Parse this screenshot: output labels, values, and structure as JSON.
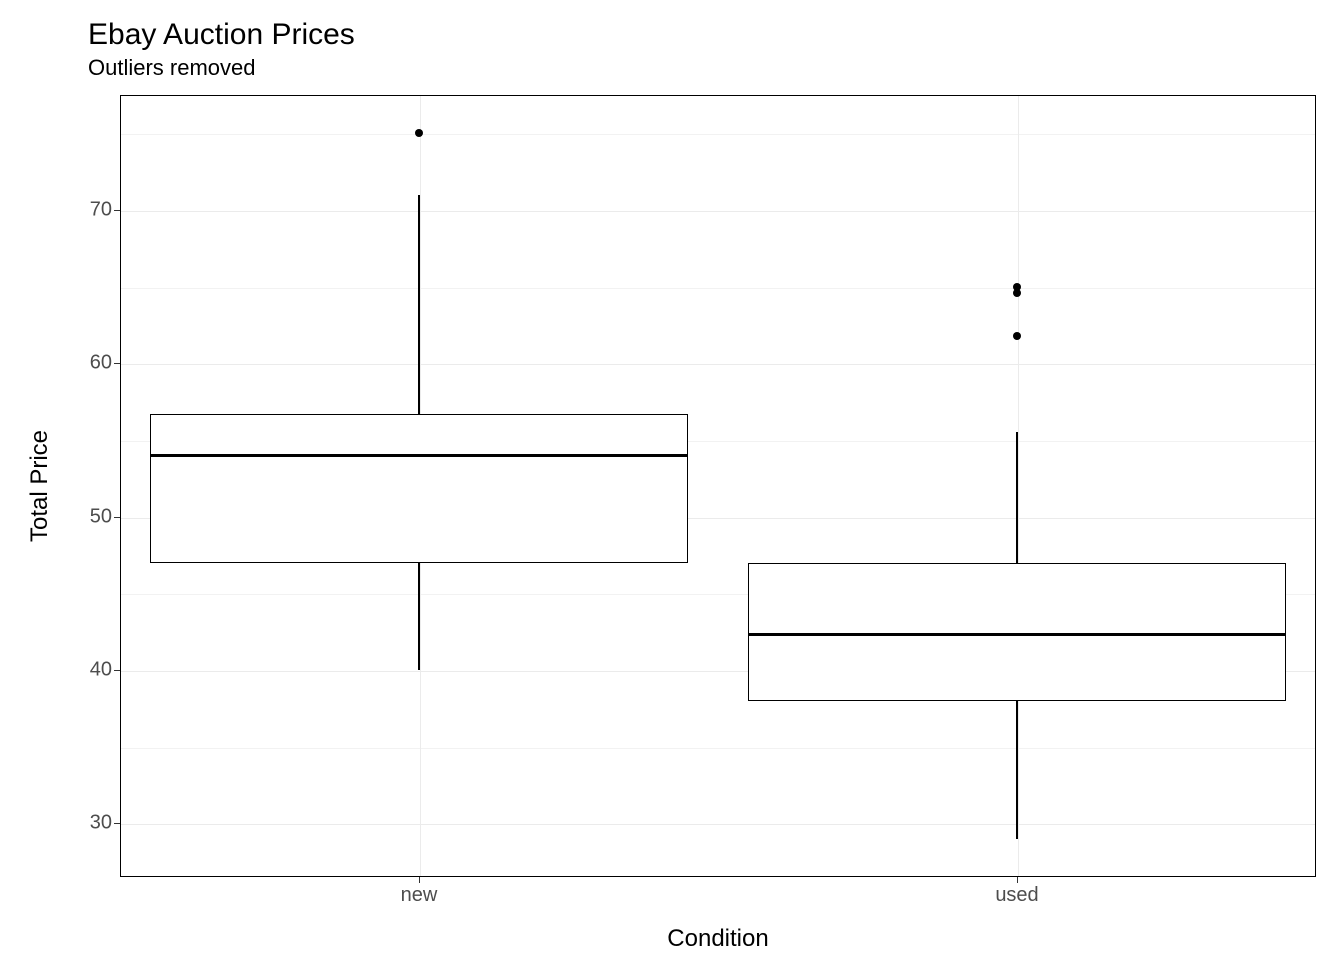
{
  "chart_data": {
    "type": "boxplot",
    "title": "Ebay Auction Prices",
    "subtitle": "Outliers removed",
    "xlabel": "Condition",
    "ylabel": "Total Price",
    "categories": [
      "new",
      "used"
    ],
    "y_ticks": [
      30,
      40,
      50,
      60,
      70
    ],
    "y_minor": [
      35,
      45,
      55,
      65,
      75
    ],
    "ylim": [
      26.5,
      77.5
    ],
    "series": [
      {
        "name": "new",
        "lower_whisker": 40,
        "q1": 47,
        "median": 54,
        "q3": 56.7,
        "upper_whisker": 71,
        "outliers": [
          75
        ]
      },
      {
        "name": "used",
        "lower_whisker": 29,
        "q1": 38,
        "median": 42.3,
        "q3": 47,
        "upper_whisker": 55.5,
        "outliers": [
          61.8,
          64.6,
          65
        ]
      }
    ]
  }
}
